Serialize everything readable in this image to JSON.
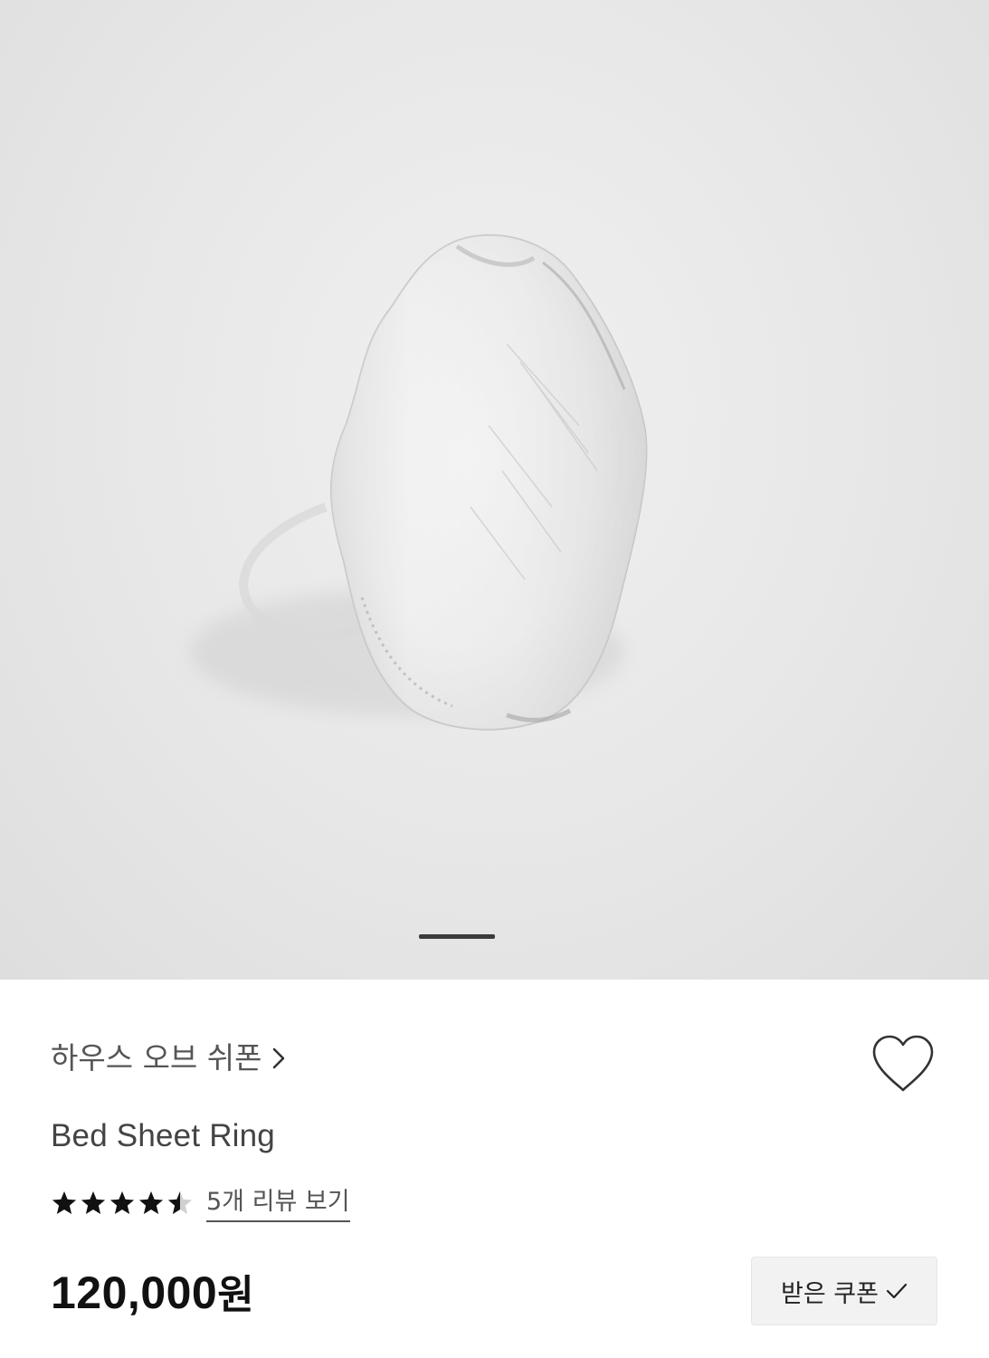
{
  "product_image": {
    "alt": "Bed Sheet Ring",
    "pager_active_index": 0
  },
  "brand": {
    "name": "하우스 오브 쉬폰",
    "chevron_icon": "chevron-right-icon"
  },
  "wishlist": {
    "icon": "heart-outline-icon"
  },
  "product": {
    "title": "Bed Sheet Ring",
    "rating": 4.5,
    "rating_max": 5,
    "review_link": "5개 리뷰 보기",
    "price": "120,000",
    "currency": "원"
  },
  "coupon": {
    "label": "받은 쿠폰",
    "icon": "check-icon"
  },
  "colors": {
    "text_dark": "#111111",
    "text_muted": "#555555",
    "button_bg": "#f2f2f2",
    "image_bg": "#e7e7e7"
  }
}
